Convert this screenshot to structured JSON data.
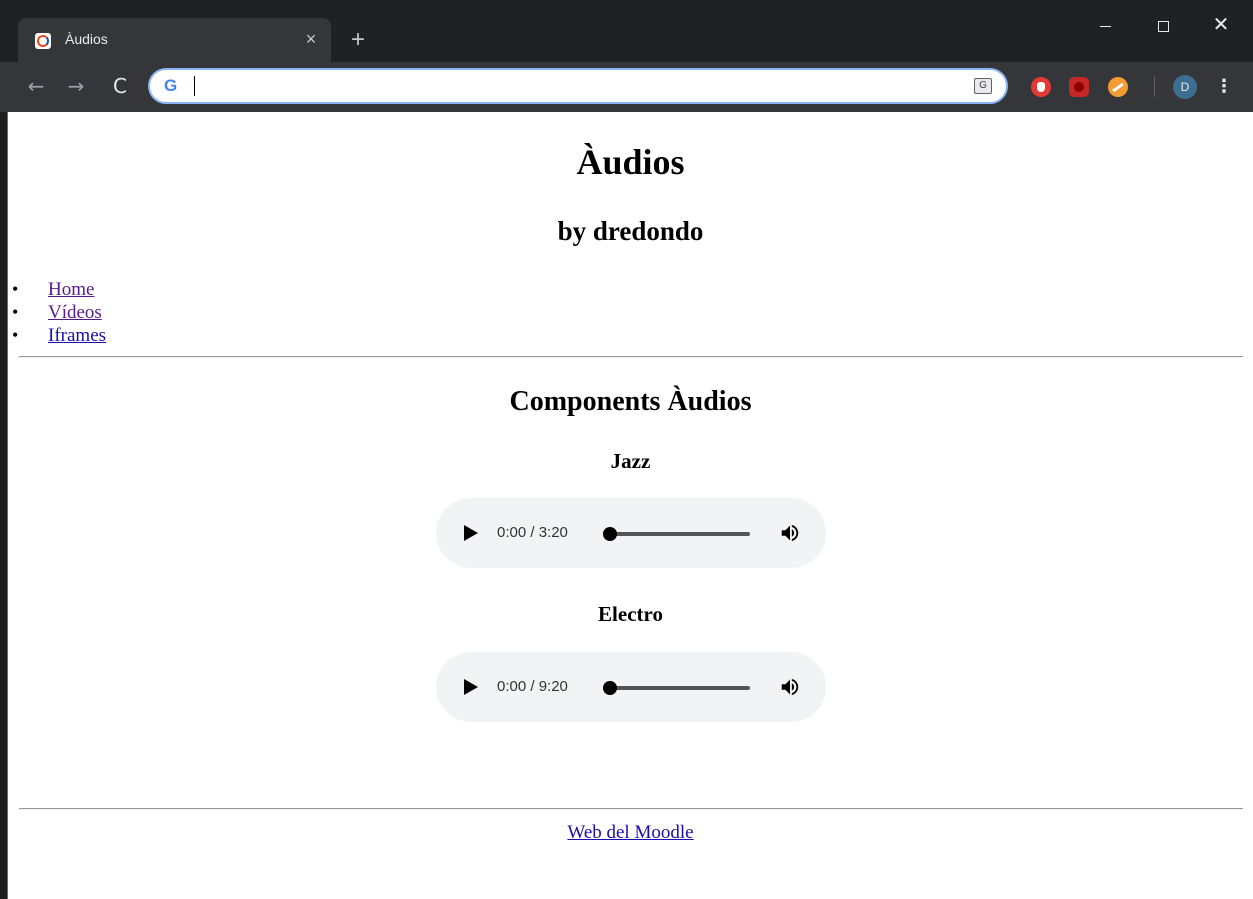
{
  "browser": {
    "tab_title": "Àudios",
    "tab_close": "×",
    "new_tab": "+",
    "omnibox_value": "",
    "translate_icon_text": "G",
    "profile_initial": "D",
    "menu": "⋮",
    "back": "←",
    "forward": "→",
    "reload": "C",
    "window_close": "✕",
    "google_logo": "G",
    "icons": {
      "favicon": "moodle-favicon-icon",
      "translate": "translate-icon",
      "extensions": [
        "adblock-icon",
        "red-cube-extension-icon",
        "orange-extension-icon"
      ]
    }
  },
  "page": {
    "title": "Àudios",
    "subtitle": "by dredondo",
    "nav": [
      {
        "label": "Home",
        "visited": true
      },
      {
        "label": "Vídeos",
        "visited": true
      },
      {
        "label": "Iframes",
        "visited": false
      }
    ],
    "section_title": "Components Àudios",
    "tracks": [
      {
        "title": "Jazz",
        "time": "0:00 / 3:20",
        "progress": 0
      },
      {
        "title": "Electro",
        "time": "0:00 / 9:20",
        "progress": 0
      }
    ],
    "footer_link": "Web del Moodle"
  },
  "colors": {
    "chrome_bg": "#202124",
    "toolbar_bg": "#35363a",
    "link": "#1a0dab",
    "visited_link": "#551a8b",
    "player_bg": "#f1f3f4"
  }
}
